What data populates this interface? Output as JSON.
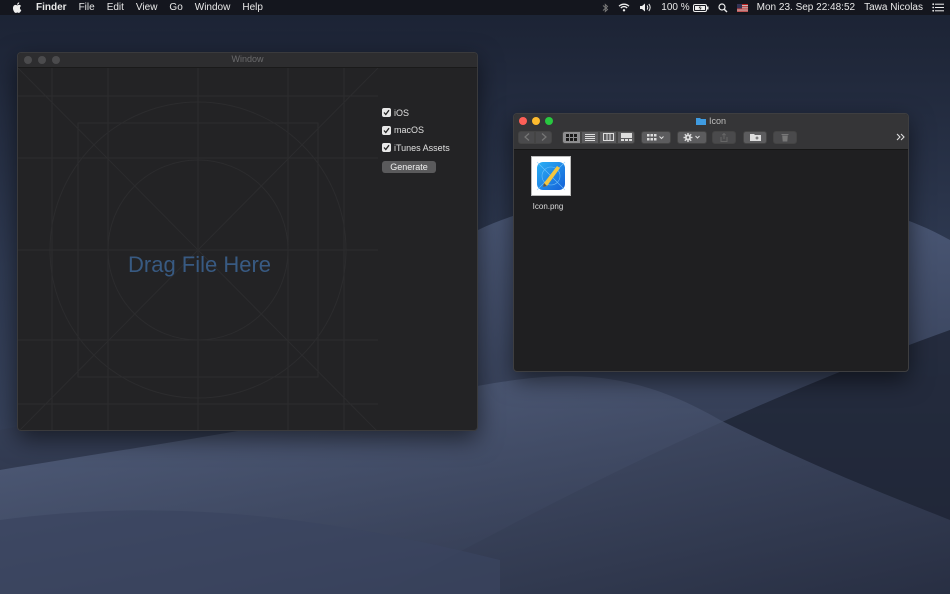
{
  "menubar": {
    "app_name": "Finder",
    "menus": [
      "File",
      "Edit",
      "View",
      "Go",
      "Window",
      "Help"
    ],
    "battery": "100 %",
    "datetime": "Mon 23. Sep  22:48:52",
    "user": "Tawa Nicolas"
  },
  "app_window": {
    "title": "Window",
    "drop_label": "Drag File Here",
    "options": [
      {
        "label": "iOS",
        "checked": true
      },
      {
        "label": "macOS",
        "checked": true
      },
      {
        "label": "iTunes Assets",
        "checked": true
      }
    ],
    "generate_label": "Generate"
  },
  "finder": {
    "title": "Icon",
    "files": [
      {
        "name": "Icon.png"
      }
    ],
    "toolbar_icons": [
      "back-icon",
      "forward-icon",
      "icon-view-icon",
      "list-view-icon",
      "column-view-icon",
      "gallery-view-icon",
      "group-icon",
      "action-gear-icon",
      "share-icon",
      "new-folder-icon",
      "trash-icon",
      "more-icon"
    ]
  },
  "colors": {
    "accent_drop": "#385a82",
    "close": "#fe5f57",
    "minimize": "#febb2e",
    "zoom": "#28c840"
  }
}
